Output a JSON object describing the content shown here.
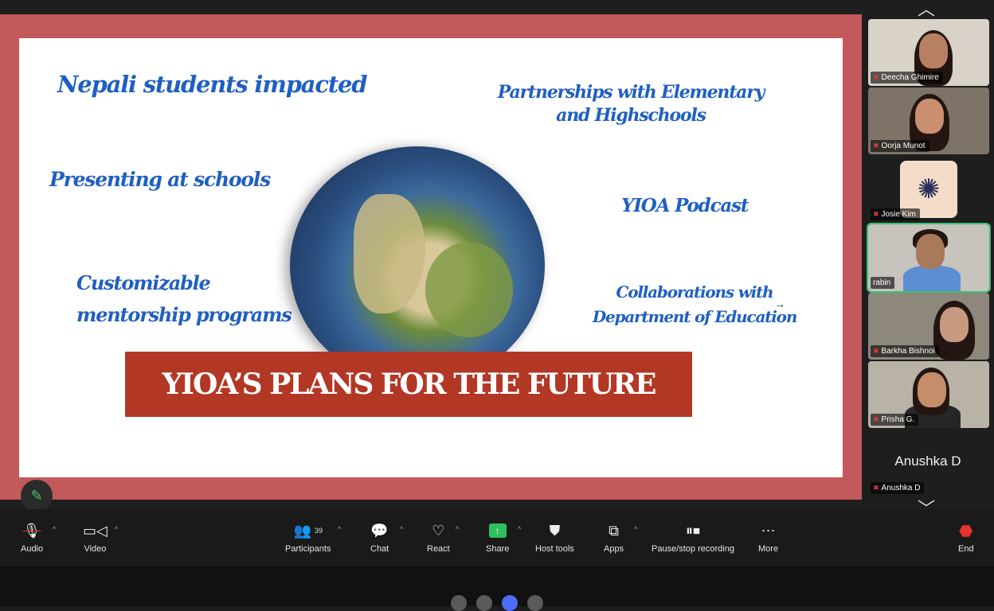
{
  "slide": {
    "title_banner": "YIOA’S PLANS FOR THE FUTURE",
    "items": [
      "Nepali students impacted",
      "Partnerships with Elementary and Highschools",
      "Presenting at schools",
      "YIOA Podcast",
      "Customizable mentorship programs",
      "Collaborations with Department of Education"
    ]
  },
  "participants_panel": {
    "tiles": [
      {
        "name": "Deecha Ghimire",
        "muted": true
      },
      {
        "name": "Oorja Munot",
        "muted": true
      },
      {
        "name": "Josie Kim",
        "muted": true
      },
      {
        "name": "rabin",
        "muted": false,
        "active_speaker": true
      },
      {
        "name": "Barkha Bishnoi",
        "muted": true
      },
      {
        "name": "Prisha G.",
        "muted": true
      },
      {
        "name": "Anushka D",
        "muted": true,
        "video_off": true
      }
    ]
  },
  "toolbar": {
    "audio": "Audio",
    "video": "Video",
    "participants": "Participants",
    "participants_count": "39",
    "chat": "Chat",
    "react": "React",
    "share": "Share",
    "host_tools": "Host tools",
    "apps": "Apps",
    "record": "Pause/stop recording",
    "more": "More",
    "end": "End"
  },
  "colors": {
    "accent_green": "#2fbf5f",
    "end_red": "#e8322f",
    "banner_red": "#b33725",
    "slide_text_blue": "#1f5fc2"
  }
}
